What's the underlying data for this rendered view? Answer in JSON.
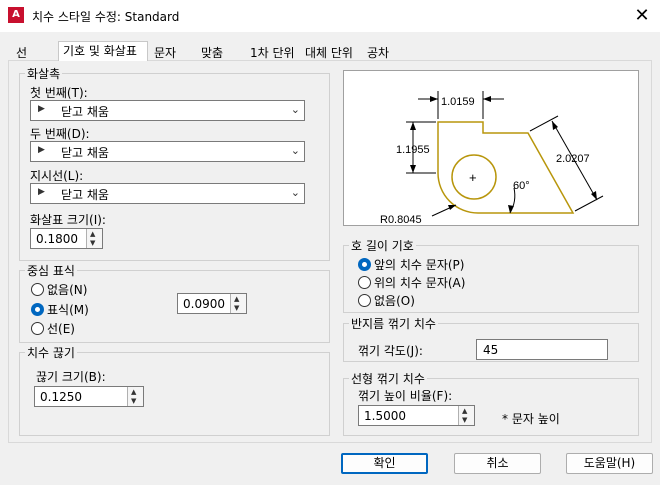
{
  "window": {
    "title": "치수 스타일 수정: Standard",
    "app_icon": "A"
  },
  "tabs": [
    {
      "label": "선"
    },
    {
      "label": "기호 및 화살표"
    },
    {
      "label": "문자"
    },
    {
      "label": "맞춤"
    },
    {
      "label": "1차 단위"
    },
    {
      "label": "대체 단위"
    },
    {
      "label": "공차"
    }
  ],
  "arrowheads": {
    "group_label": "화살촉",
    "first_label": "첫 번째(T):",
    "first_value": "닫고 채움",
    "second_label": "두 번째(D):",
    "second_value": "닫고 채움",
    "leader_label": "지시선(L):",
    "leader_value": "닫고 채움",
    "size_label": "화살표 크기(I):",
    "size_value": "0.1800"
  },
  "center_marks": {
    "group_label": "중심 표식",
    "options": [
      {
        "label": "없음(N)"
      },
      {
        "label": "표식(M)"
      },
      {
        "label": "선(E)"
      }
    ],
    "selected_index": 1,
    "size_value": "0.0900"
  },
  "dim_break": {
    "group_label": "치수 끊기",
    "size_label": "끊기 크기(B):",
    "size_value": "0.1250"
  },
  "preview": {
    "dim_top": "1.0159",
    "dim_left": "1.1955",
    "dim_right": "2.0207",
    "angle": "60°",
    "radius": "R0.8045",
    "center": "+"
  },
  "arc_length": {
    "group_label": "호 길이 기호",
    "options": [
      {
        "label": "앞의 치수 문자(P)"
      },
      {
        "label": "위의 치수 문자(A)"
      },
      {
        "label": "없음(O)"
      }
    ],
    "selected_index": 0
  },
  "radius_jog": {
    "group_label": "반지름 꺾기 치수",
    "angle_label": "꺾기 각도(J):",
    "angle_value": "45"
  },
  "linear_jog": {
    "group_label": "선형 꺾기 치수",
    "factor_label": "꺾기 높이 비율(F):",
    "factor_value": "1.5000",
    "suffix": "* 문자 높이"
  },
  "buttons": {
    "ok": "확인",
    "cancel": "취소",
    "help": "도움말(H)"
  },
  "colors": {
    "accent": "#0067c0",
    "shape": "#b8960c"
  }
}
